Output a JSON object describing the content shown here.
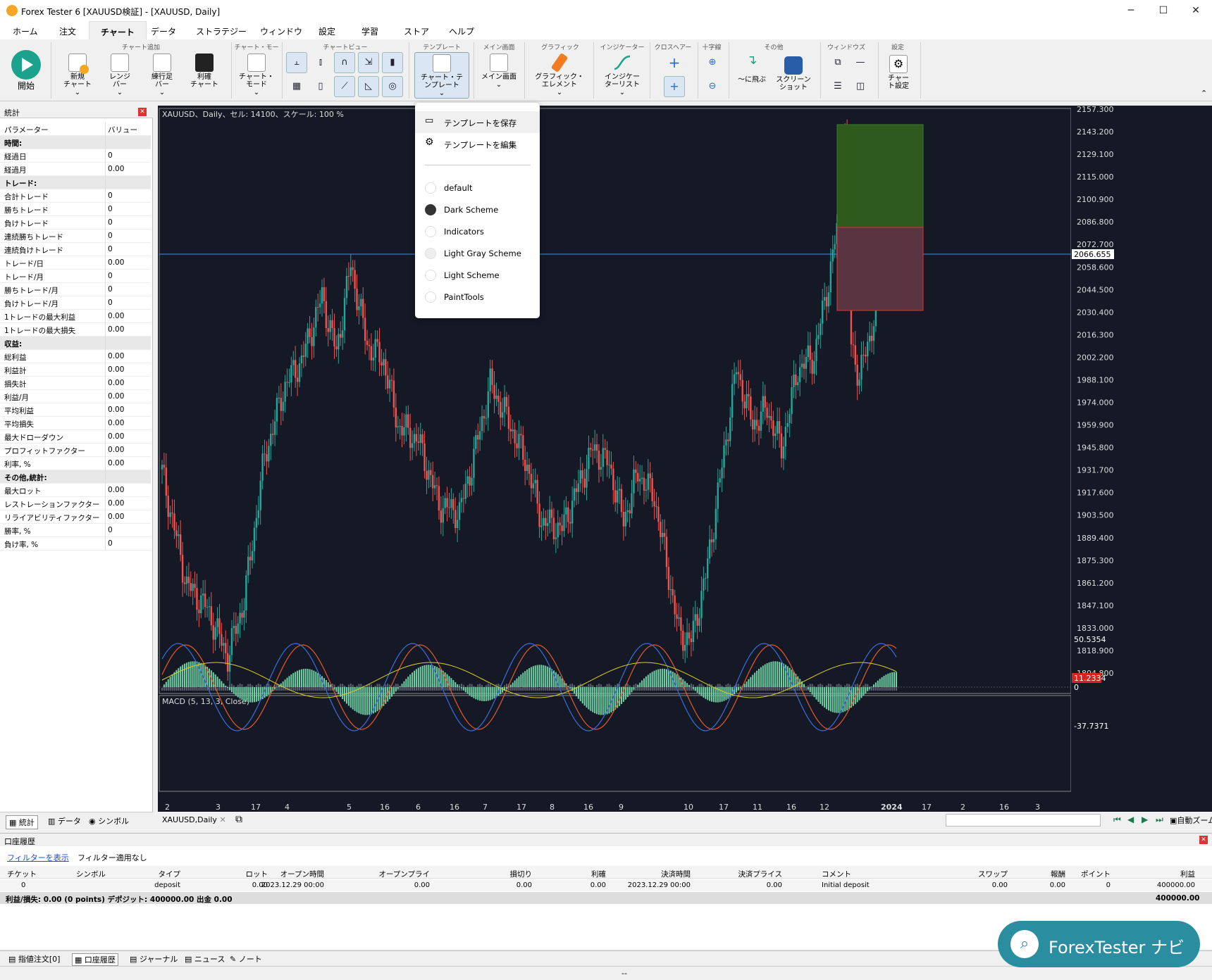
{
  "window": {
    "title": "Forex Tester 6  [XAUUSD検証] - [XAUUSD, Daily]",
    "min": "─",
    "max": "☐",
    "close": "✕"
  },
  "menu": [
    "ホーム",
    "注文",
    "チャート",
    "データ",
    "ストラテジー",
    "ウィンドウ",
    "設定",
    "学習",
    "ストア",
    "ヘルプ"
  ],
  "ribbon": {
    "start": "開始",
    "g_add": "チャート追加",
    "new_chart": "新規\nチャート",
    "range_bar": "レンジ\nバー",
    "renko": "練行足\nバー",
    "profit_chart": "利確\nチャート",
    "g_mode": "チャート・モード",
    "chart_mode": "チャート・\nモード",
    "g_view": "チャートビュー",
    "g_template": "テンプレート",
    "chart_template": "チャート・テ\nンプレート",
    "g_main": "メイン画面",
    "main_screen": "メイン画面",
    "g_graphic": "グラフィック",
    "graphic_element": "グラフィック・\nエレメント",
    "g_indicator": "インジケーター",
    "indicator_list": "インジケー\nターリスト",
    "g_crosshair": "クロスヘアー",
    "g_cross": "十字線",
    "g_other": "その他",
    "jump": "〜に飛ぶ",
    "screenshot": "スクリーン\nショット",
    "g_window": "ウィンドウズ",
    "g_settings": "設定",
    "chart_settings": "チャー\nト設定"
  },
  "stats": {
    "title": "統計",
    "col_param": "パラメーター",
    "col_value": "バリュー",
    "rows": [
      {
        "k": "時間:",
        "sec": true
      },
      {
        "k": "経過日",
        "v": "0"
      },
      {
        "k": "経過月",
        "v": "0.00"
      },
      {
        "k": "トレード:",
        "sec": true
      },
      {
        "k": "合計トレード",
        "v": "0"
      },
      {
        "k": "勝ちトレード",
        "v": "0"
      },
      {
        "k": "負けトレード",
        "v": "0"
      },
      {
        "k": "連続勝ちトレード",
        "v": "0"
      },
      {
        "k": "連続負けトレード",
        "v": "0"
      },
      {
        "k": "トレード/日",
        "v": "0.00"
      },
      {
        "k": "トレード/月",
        "v": "0"
      },
      {
        "k": "勝ちトレード/月",
        "v": "0"
      },
      {
        "k": "負けトレード/月",
        "v": "0"
      },
      {
        "k": "1トレードの最大利益",
        "v": "0.00"
      },
      {
        "k": "1トレードの最大損失",
        "v": "0.00"
      },
      {
        "k": "収益:",
        "sec": true
      },
      {
        "k": "総利益",
        "v": "0.00"
      },
      {
        "k": "利益計",
        "v": "0.00"
      },
      {
        "k": "損失計",
        "v": "0.00"
      },
      {
        "k": "利益/月",
        "v": "0.00"
      },
      {
        "k": "平均利益",
        "v": "0.00"
      },
      {
        "k": "平均損失",
        "v": "0.00"
      },
      {
        "k": "最大ドローダウン",
        "v": "0.00"
      },
      {
        "k": "プロフィットファクター",
        "v": "0.00"
      },
      {
        "k": "利率, %",
        "v": "0.00"
      },
      {
        "k": "その他,統計:",
        "sec": true
      },
      {
        "k": "最大ロット",
        "v": "0.00"
      },
      {
        "k": "レストレーションファクター",
        "v": "0.00"
      },
      {
        "k": "リライアビリティファクター",
        "v": "0.00"
      },
      {
        "k": "勝率, %",
        "v": "0"
      },
      {
        "k": "負け率, %",
        "v": "0"
      }
    ]
  },
  "left_tabs": [
    "統計",
    "データ",
    "シンボル"
  ],
  "chart": {
    "header": "XAUUSD、Daily、セル: 14100、スケール: 100 %",
    "price_labels": [
      "2157.300",
      "2143.200",
      "2129.100",
      "2115.000",
      "2100.900",
      "2086.800",
      "2072.700",
      "2058.600",
      "2044.500",
      "2030.400",
      "2016.300",
      "2002.200",
      "1988.100",
      "1974.000",
      "1959.900",
      "1945.800",
      "1931.700",
      "1917.600",
      "1903.500",
      "1889.400",
      "1875.300",
      "1861.200",
      "1847.100",
      "1833.000",
      "1818.900",
      "1804.800"
    ],
    "current_price": "2066.655",
    "macd_header": "MACD (5, 13, 3, Close)",
    "macd_labels": [
      "50.5354",
      "11.2334",
      "0",
      "-37.7371"
    ],
    "date_labels": [
      "2",
      "3",
      "17",
      "4",
      "5",
      "16",
      "6",
      "16",
      "7",
      "17",
      "8",
      "16",
      "9",
      "10",
      "17",
      "11",
      "16",
      "12",
      "2024",
      "17",
      "2",
      "16",
      "3"
    ],
    "tab": "XAUUSD,Daily",
    "zoom": "自動ズーム"
  },
  "template_menu": {
    "save": "テンプレートを保存",
    "edit": "テンプレートを編集",
    "items": [
      "default",
      "Dark Scheme",
      "Indicators",
      "Light Gray Scheme",
      "Light Scheme",
      "PaintTools"
    ],
    "selected": "Dark Scheme"
  },
  "history": {
    "title": "口座履歴",
    "filter_link": "フィルターを表示",
    "filter_status": "フィルター適用なし",
    "columns": [
      "チケット",
      "シンボル",
      "タイプ",
      "ロット",
      "オープン時間",
      "オープンプライス",
      "損切り",
      "利確",
      "決済時間",
      "決済プライス",
      "コメント",
      "スワップ",
      "報酬",
      "ポイント",
      "利益"
    ],
    "row": [
      "0",
      "",
      "deposit",
      "0.00",
      "2023.12.29 00:00",
      "0.00",
      "0.00",
      "0.00",
      "2023.12.29 00:00",
      "0.00",
      "Initial deposit",
      "0.00",
      "0.00",
      "0",
      "400000.00"
    ],
    "summary": "利益/損失: 0.00 (0 points) デポジット: 400000.00 出金 0.00",
    "summary_total": "400000.00"
  },
  "bottom_tabs": [
    "指値注文[0]",
    "口座履歴",
    "ジャーナル",
    "ニュース",
    "ノート"
  ],
  "status": "--",
  "navi": "ForexTester ナビ",
  "colors": {
    "bull": "#26a69a",
    "bear": "#ef5350",
    "bg": "#141925",
    "accent": "#2a8ea0"
  }
}
